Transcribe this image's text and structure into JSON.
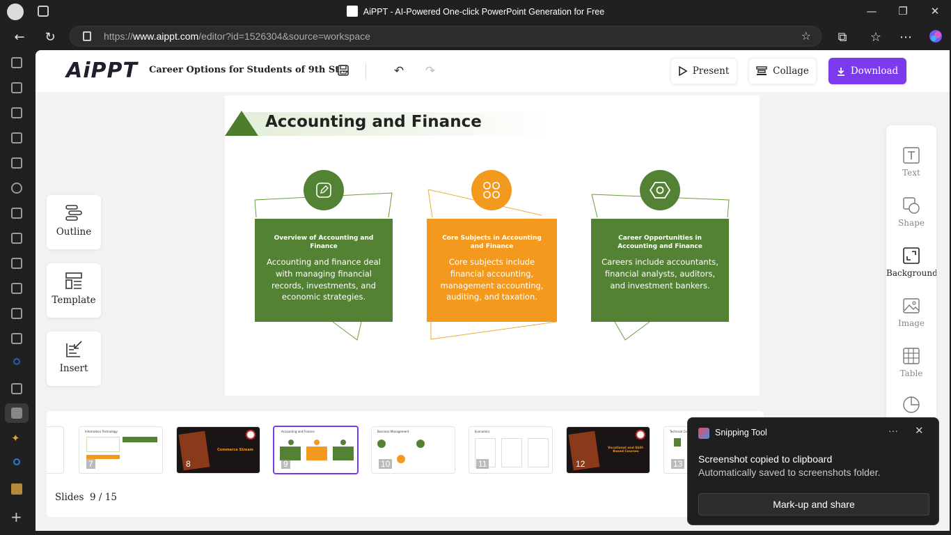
{
  "browser": {
    "window_title": "AiPPT - AI-Powered One-click PowerPoint Generation for Free",
    "url_prefix": "https://",
    "url_domain": "www.aippt.com",
    "url_path": "/editor?id=1526304&source=workspace"
  },
  "header": {
    "logo": "AiPPT",
    "doc_title": "Career Options for Students of 9th St...",
    "present_label": "Present",
    "collage_label": "Collage",
    "download_label": "Download"
  },
  "left_tools": [
    {
      "label": "Outline"
    },
    {
      "label": "Template"
    },
    {
      "label": "Insert"
    }
  ],
  "right_tools": [
    {
      "label": "Text"
    },
    {
      "label": "Shape"
    },
    {
      "label": "Background"
    },
    {
      "label": "Image"
    },
    {
      "label": "Table"
    }
  ],
  "slide": {
    "title": "Accounting and Finance",
    "cards": [
      {
        "title": "Overview of Accounting and Finance",
        "body": "Accounting and finance deal with managing financial records, investments, and economic strategies.",
        "color": "#548235"
      },
      {
        "title": "Core Subjects in Accounting and Finance",
        "body": "Core subjects include financial accounting, management accounting, auditing, and taxation.",
        "color": "#f39a1e"
      },
      {
        "title": "Career Opportunities in Accounting and Finance",
        "body": "Careers include accountants, financial analysts, auditors, and investment bankers.",
        "color": "#548235"
      }
    ]
  },
  "thumbnails": {
    "items": [
      {
        "num": "7",
        "title": "Information Technology"
      },
      {
        "num": "8",
        "title": "Commerce Stream"
      },
      {
        "num": "9",
        "title": "Accounting and Finance"
      },
      {
        "num": "10",
        "title": "Business Management"
      },
      {
        "num": "11",
        "title": "Economics"
      },
      {
        "num": "12",
        "title": "Vocational and Skill-Based Courses"
      },
      {
        "num": "13",
        "title": "Technical Co..."
      }
    ],
    "slides_label": "Slides",
    "current": "9 / 15"
  },
  "toast": {
    "app_name": "Snipping Tool",
    "line1": "Screenshot copied to clipboard",
    "line2": "Automatically saved to screenshots folder.",
    "button": "Mark-up and share",
    "more": "···",
    "close": "✕"
  },
  "colors": {
    "accent": "#7c3aed",
    "green": "#548235",
    "orange": "#f39a1e"
  }
}
